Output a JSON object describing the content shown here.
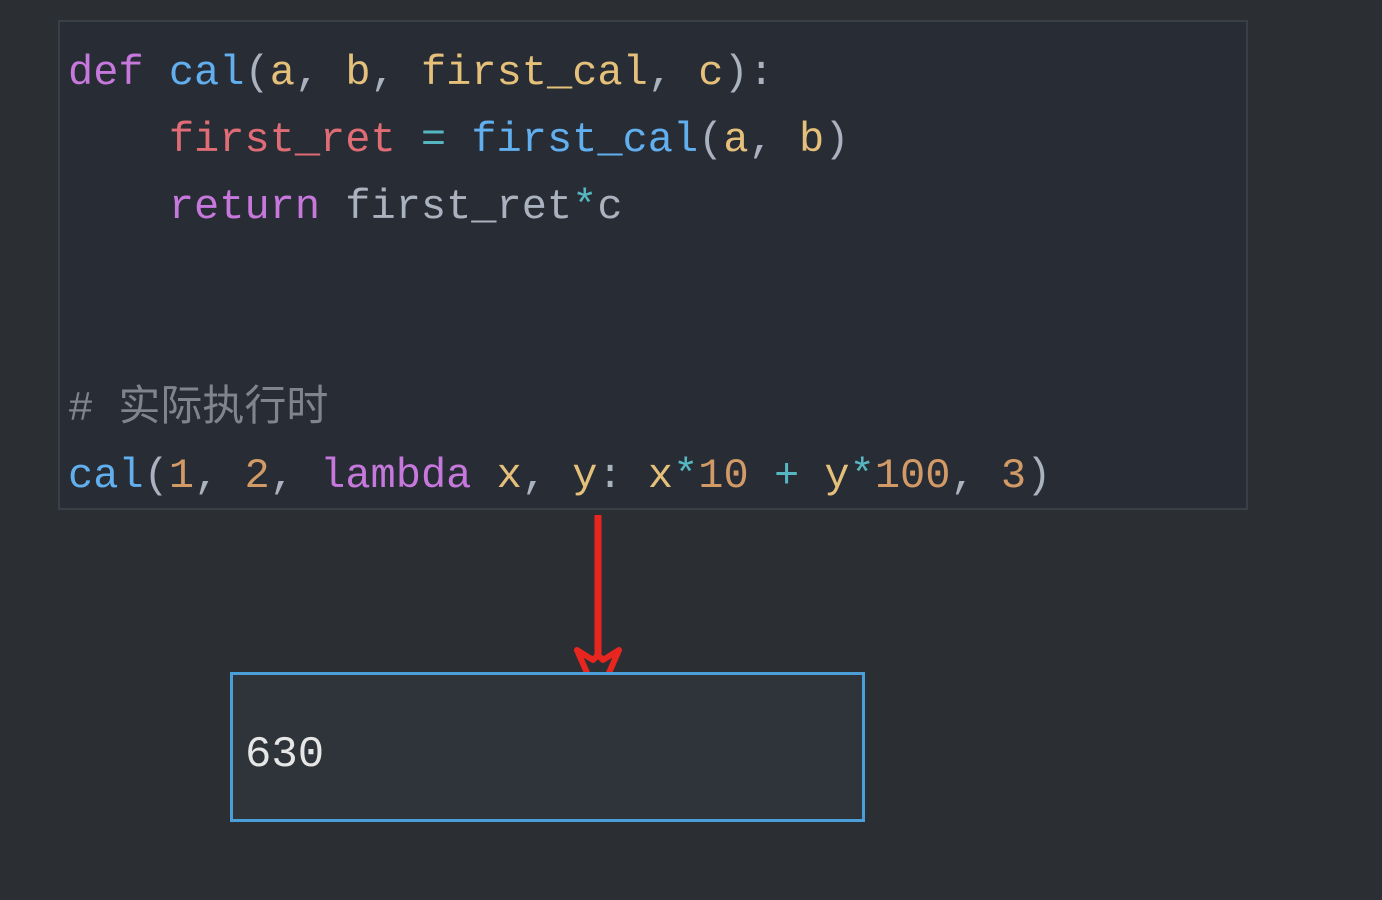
{
  "code": {
    "line1": {
      "def": "def",
      "func": "cal",
      "lp": "(",
      "a": "a",
      "c1": ", ",
      "b": "b",
      "c2": ", ",
      "first_cal": "first_cal",
      "c3": ", ",
      "cc": "c",
      "rp": "):"
    },
    "line2": {
      "indent": "    ",
      "first_ret": "first_ret",
      "sp1": " ",
      "eq": "=",
      "sp2": " ",
      "first_cal": "first_cal",
      "lp": "(",
      "a": "a",
      "c1": ", ",
      "b": "b",
      "rp": ")"
    },
    "line3": {
      "indent": "    ",
      "return": "return",
      "sp": " ",
      "first_ret": "first_ret",
      "star": "*",
      "c": "c"
    },
    "comment": {
      "text": "# 实际执行时"
    },
    "line7": {
      "cal": "cal",
      "lp": "(",
      "n1": "1",
      "c1": ", ",
      "n2": "2",
      "c2": ", ",
      "lambda": "lambda",
      "sp1": " ",
      "x": "x",
      "c3": ", ",
      "y": "y",
      "colon": ": ",
      "xx": "x",
      "star1": "*",
      "n10": "10",
      "sp2": " ",
      "plus": "+",
      "sp3": " ",
      "yy": "y",
      "star2": "*",
      "n100": "100",
      "c4": ", ",
      "n3": "3",
      "rp": ")"
    }
  },
  "output": "630"
}
